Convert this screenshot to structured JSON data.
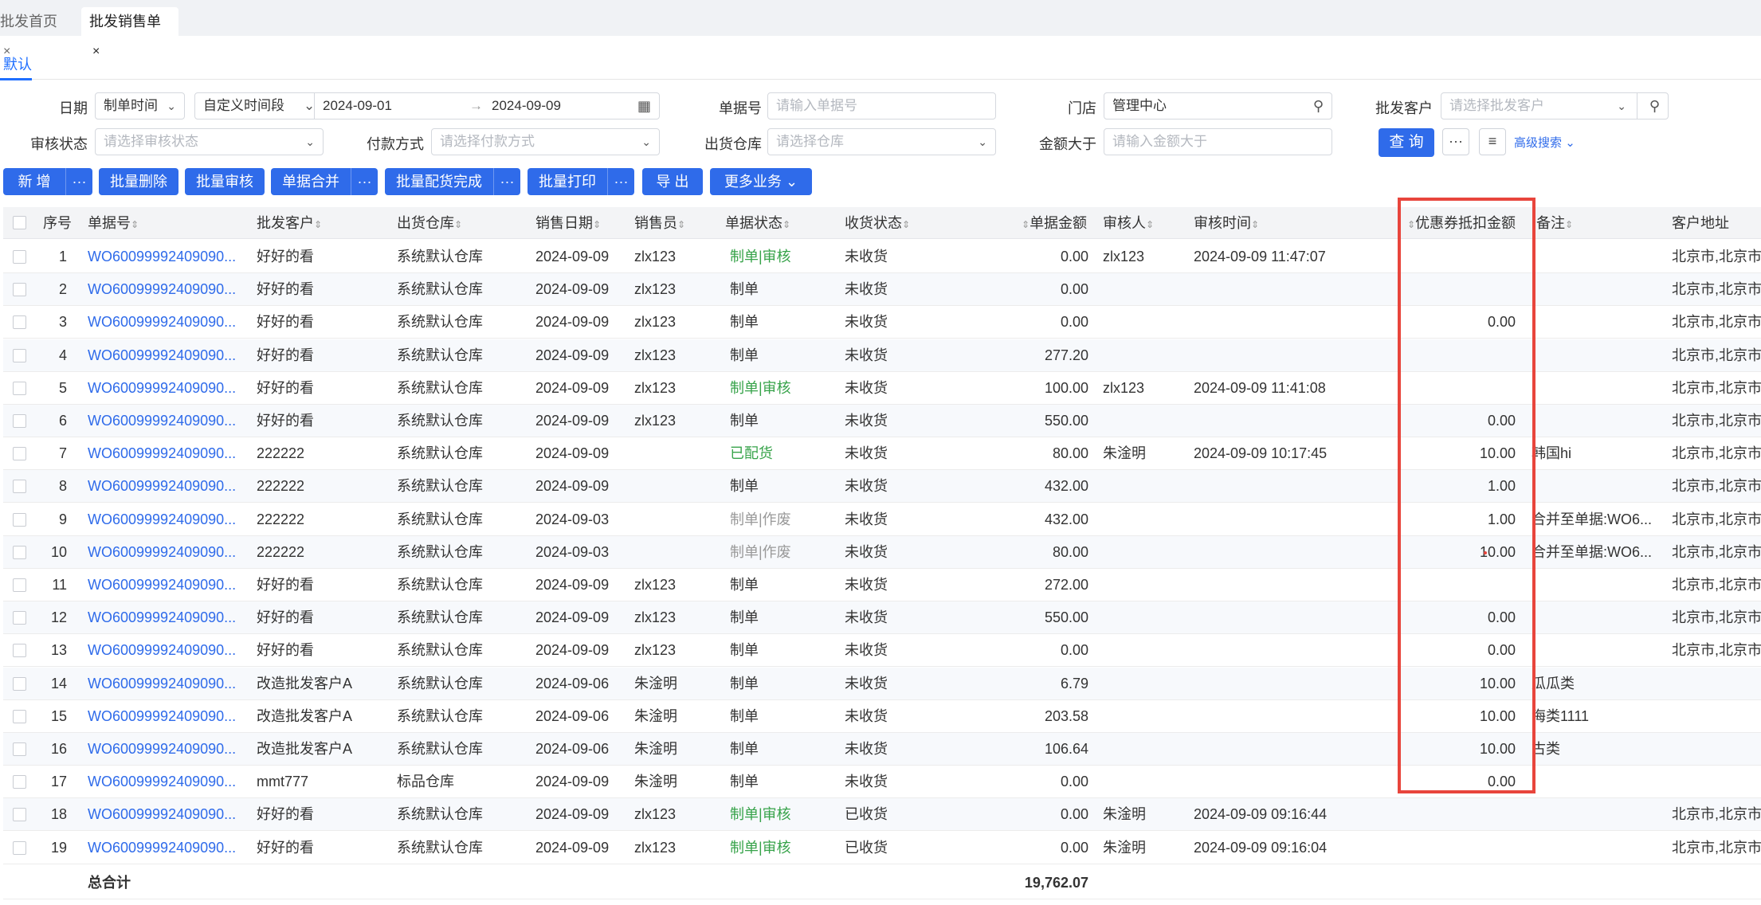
{
  "tabs": [
    {
      "label": "批发首页",
      "close": "×"
    },
    {
      "label": "批发销售单",
      "close": "×"
    }
  ],
  "view_tab": "默认",
  "filters": {
    "date_label": "日期",
    "date_type": "制单时间",
    "date_range_type": "自定义时间段",
    "date_from": "2024-09-01",
    "date_arrow": "→",
    "date_to": "2024-09-09",
    "order_no_label": "单据号",
    "order_no_placeholder": "请输入单据号",
    "store_label": "门店",
    "store_value": "管理中心",
    "customer_label": "批发客户",
    "customer_placeholder": "请选择批发客户",
    "audit_label": "审核状态",
    "audit_placeholder": "请选择审核状态",
    "pay_label": "付款方式",
    "pay_placeholder": "请选择付款方式",
    "warehouse_label": "出货仓库",
    "warehouse_placeholder": "请选择仓库",
    "amount_label": "金额大于",
    "amount_placeholder": "请输入金额大于",
    "query_button": "查 询",
    "more_button": "···",
    "advanced_search": "高级搜索"
  },
  "actions": {
    "add": "新 增",
    "batch_delete": "批量删除",
    "batch_audit": "批量审核",
    "merge": "单据合并",
    "batch_complete": "批量配货完成",
    "batch_print": "批量打印",
    "export": "导 出",
    "more_business": "更多业务",
    "more": "···"
  },
  "columns": {
    "seq": "序号",
    "order_no": "单据号",
    "customer": "批发客户",
    "warehouse": "出货仓库",
    "sale_date": "销售日期",
    "seller": "销售员",
    "status": "单据状态",
    "receive": "收货状态",
    "amount": "单据金额",
    "auditor": "审核人",
    "audit_time": "审核时间",
    "coupon": "优惠券抵扣金额",
    "remark": "备注",
    "address": "客户地址"
  },
  "rows": [
    {
      "seq": "1",
      "no": "WO60099992409090...",
      "customer": "好好的看",
      "warehouse": "系统默认仓库",
      "date": "2024-09-09",
      "seller": "zlx123",
      "status": "制单|审核",
      "status_color": "green",
      "receive": "未收货",
      "amount": "0.00",
      "auditor": "zlx123",
      "audit_time": "2024-09-09 11:47:07",
      "coupon": "",
      "remark": "",
      "address": "北京市,北京市,"
    },
    {
      "seq": "2",
      "no": "WO60099992409090...",
      "customer": "好好的看",
      "warehouse": "系统默认仓库",
      "date": "2024-09-09",
      "seller": "zlx123",
      "status": "制单",
      "status_color": "",
      "receive": "未收货",
      "amount": "0.00",
      "auditor": "",
      "audit_time": "",
      "coupon": "",
      "remark": "",
      "address": "北京市,北京市,"
    },
    {
      "seq": "3",
      "no": "WO60099992409090...",
      "customer": "好好的看",
      "warehouse": "系统默认仓库",
      "date": "2024-09-09",
      "seller": "zlx123",
      "status": "制单",
      "status_color": "",
      "receive": "未收货",
      "amount": "0.00",
      "auditor": "",
      "audit_time": "",
      "coupon": "0.00",
      "remark": "",
      "address": "北京市,北京市,"
    },
    {
      "seq": "4",
      "no": "WO60099992409090...",
      "customer": "好好的看",
      "warehouse": "系统默认仓库",
      "date": "2024-09-09",
      "seller": "zlx123",
      "status": "制单",
      "status_color": "",
      "receive": "未收货",
      "amount": "277.20",
      "auditor": "",
      "audit_time": "",
      "coupon": "",
      "remark": "",
      "address": "北京市,北京市,"
    },
    {
      "seq": "5",
      "no": "WO60099992409090...",
      "customer": "好好的看",
      "warehouse": "系统默认仓库",
      "date": "2024-09-09",
      "seller": "zlx123",
      "status": "制单|审核",
      "status_color": "green",
      "receive": "未收货",
      "amount": "100.00",
      "auditor": "zlx123",
      "audit_time": "2024-09-09 11:41:08",
      "coupon": "",
      "remark": "",
      "address": "北京市,北京市,"
    },
    {
      "seq": "6",
      "no": "WO60099992409090...",
      "customer": "好好的看",
      "warehouse": "系统默认仓库",
      "date": "2024-09-09",
      "seller": "zlx123",
      "status": "制单",
      "status_color": "",
      "receive": "未收货",
      "amount": "550.00",
      "auditor": "",
      "audit_time": "",
      "coupon": "0.00",
      "remark": "",
      "address": "北京市,北京市,"
    },
    {
      "seq": "7",
      "no": "WO60099992409090...",
      "customer": "222222",
      "warehouse": "系统默认仓库",
      "date": "2024-09-09",
      "seller": "",
      "status": "已配货",
      "status_color": "green",
      "receive": "未收货",
      "amount": "80.00",
      "auditor": "朱淦明",
      "audit_time": "2024-09-09 10:17:45",
      "coupon": "10.00",
      "remark": "韩国hi",
      "address": "北京市,北京市,"
    },
    {
      "seq": "8",
      "no": "WO60099992409090...",
      "customer": "222222",
      "warehouse": "系统默认仓库",
      "date": "2024-09-09",
      "seller": "",
      "status": "制单",
      "status_color": "",
      "receive": "未收货",
      "amount": "432.00",
      "auditor": "",
      "audit_time": "",
      "coupon": "1.00",
      "remark": "",
      "address": "北京市,北京市,"
    },
    {
      "seq": "9",
      "no": "WO60099992409090...",
      "customer": "222222",
      "warehouse": "系统默认仓库",
      "date": "2024-09-03",
      "seller": "",
      "status": "制单|作废",
      "status_color": "gray",
      "receive": "未收货",
      "amount": "432.00",
      "auditor": "",
      "audit_time": "",
      "coupon": "1.00",
      "remark": "合并至单据:WO6...",
      "address": "北京市,北京市,"
    },
    {
      "seq": "10",
      "no": "WO60099992409090...",
      "customer": "222222",
      "warehouse": "系统默认仓库",
      "date": "2024-09-03",
      "seller": "",
      "status": "制单|作废",
      "status_color": "gray",
      "receive": "未收货",
      "amount": "80.00",
      "auditor": "",
      "audit_time": "",
      "coupon": "10.00",
      "remark": "合并至单据:WO6...",
      "address": "北京市,北京市,"
    },
    {
      "seq": "11",
      "no": "WO60099992409090...",
      "customer": "好好的看",
      "warehouse": "系统默认仓库",
      "date": "2024-09-09",
      "seller": "zlx123",
      "status": "制单",
      "status_color": "",
      "receive": "未收货",
      "amount": "272.00",
      "auditor": "",
      "audit_time": "",
      "coupon": "",
      "remark": "",
      "address": "北京市,北京市,"
    },
    {
      "seq": "12",
      "no": "WO60099992409090...",
      "customer": "好好的看",
      "warehouse": "系统默认仓库",
      "date": "2024-09-09",
      "seller": "zlx123",
      "status": "制单",
      "status_color": "",
      "receive": "未收货",
      "amount": "550.00",
      "auditor": "",
      "audit_time": "",
      "coupon": "0.00",
      "remark": "",
      "address": "北京市,北京市,"
    },
    {
      "seq": "13",
      "no": "WO60099992409090...",
      "customer": "好好的看",
      "warehouse": "系统默认仓库",
      "date": "2024-09-09",
      "seller": "zlx123",
      "status": "制单",
      "status_color": "",
      "receive": "未收货",
      "amount": "0.00",
      "auditor": "",
      "audit_time": "",
      "coupon": "0.00",
      "remark": "",
      "address": "北京市,北京市,"
    },
    {
      "seq": "14",
      "no": "WO60099992409090...",
      "customer": "改造批发客户A",
      "warehouse": "系统默认仓库",
      "date": "2024-09-06",
      "seller": "朱淦明",
      "status": "制单",
      "status_color": "",
      "receive": "未收货",
      "amount": "6.79",
      "auditor": "",
      "audit_time": "",
      "coupon": "10.00",
      "remark": "瓜瓜类",
      "address": ""
    },
    {
      "seq": "15",
      "no": "WO60099992409090...",
      "customer": "改造批发客户A",
      "warehouse": "系统默认仓库",
      "date": "2024-09-06",
      "seller": "朱淦明",
      "status": "制单",
      "status_color": "",
      "receive": "未收货",
      "amount": "203.58",
      "auditor": "",
      "audit_time": "",
      "coupon": "10.00",
      "remark": "海类1111",
      "address": ""
    },
    {
      "seq": "16",
      "no": "WO60099992409090...",
      "customer": "改造批发客户A",
      "warehouse": "系统默认仓库",
      "date": "2024-09-06",
      "seller": "朱淦明",
      "status": "制单",
      "status_color": "",
      "receive": "未收货",
      "amount": "106.64",
      "auditor": "",
      "audit_time": "",
      "coupon": "10.00",
      "remark": "古类",
      "address": ""
    },
    {
      "seq": "17",
      "no": "WO60099992409090...",
      "customer": "mmt777",
      "warehouse": "标品仓库",
      "date": "2024-09-09",
      "seller": "朱淦明",
      "status": "制单",
      "status_color": "",
      "receive": "未收货",
      "amount": "0.00",
      "auditor": "",
      "audit_time": "",
      "coupon": "0.00",
      "remark": "",
      "address": ""
    },
    {
      "seq": "18",
      "no": "WO60099992409090...",
      "customer": "好好的看",
      "warehouse": "系统默认仓库",
      "date": "2024-09-09",
      "seller": "zlx123",
      "status": "制单|审核",
      "status_color": "green",
      "receive": "已收货",
      "amount": "0.00",
      "auditor": "朱淦明",
      "audit_time": "2024-09-09 09:16:44",
      "coupon": "",
      "remark": "",
      "address": "北京市,北京市,"
    },
    {
      "seq": "19",
      "no": "WO60099992409090...",
      "customer": "好好的看",
      "warehouse": "系统默认仓库",
      "date": "2024-09-09",
      "seller": "zlx123",
      "status": "制单|审核",
      "status_color": "green",
      "receive": "已收货",
      "amount": "0.00",
      "auditor": "朱淦明",
      "audit_time": "2024-09-09 09:16:04",
      "coupon": "",
      "remark": "",
      "address": "北京市,北京市,"
    }
  ],
  "total": {
    "label": "总合计",
    "amount": "19,762.07"
  },
  "colors": {
    "primary": "#2f6bea",
    "highlight": "#e8453c",
    "status_green": "#37a34a"
  }
}
